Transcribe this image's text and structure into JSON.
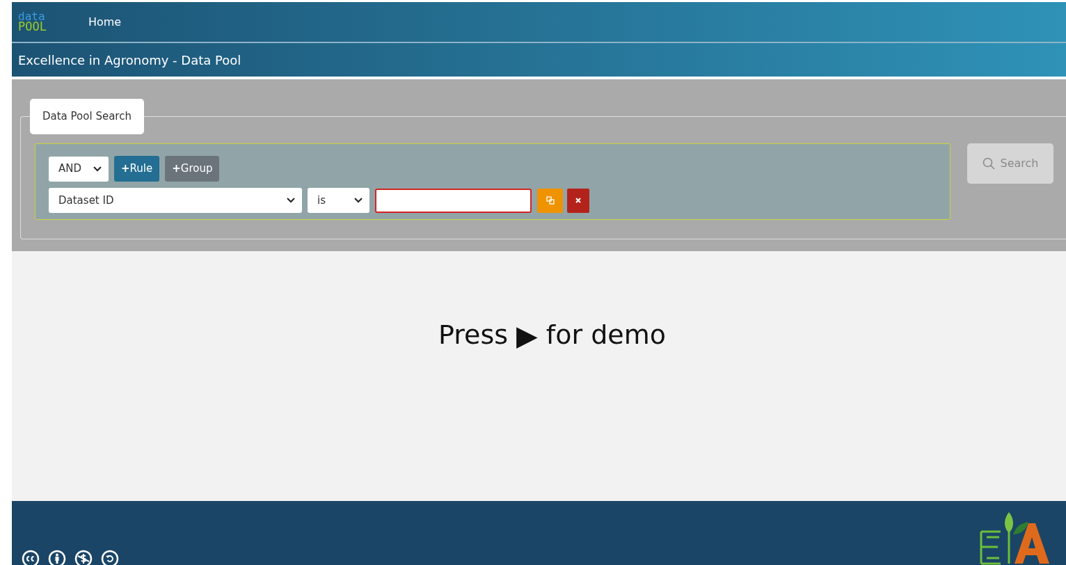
{
  "navbar": {
    "logo": {
      "top": "data",
      "bottom": "POOL"
    },
    "links": [
      {
        "label": "Home",
        "selected": false
      }
    ]
  },
  "subtitle": "Excellence in Agronomy - Data Pool",
  "search_panel": {
    "tab": "Data Pool Search",
    "conjunction": "AND",
    "buttons": [
      {
        "kind": "rule",
        "icon": "+",
        "label": "Rule"
      },
      {
        "kind": "group",
        "icon": "+",
        "label": "Group"
      }
    ],
    "rules": [
      {
        "field": "Dataset ID",
        "operator": "is",
        "invalid": true
      }
    ],
    "search_button": {
      "label": "Search",
      "disabled": true
    }
  },
  "overlay": {
    "before": "Press",
    "icon": "▶",
    "after": "for demo"
  }
}
